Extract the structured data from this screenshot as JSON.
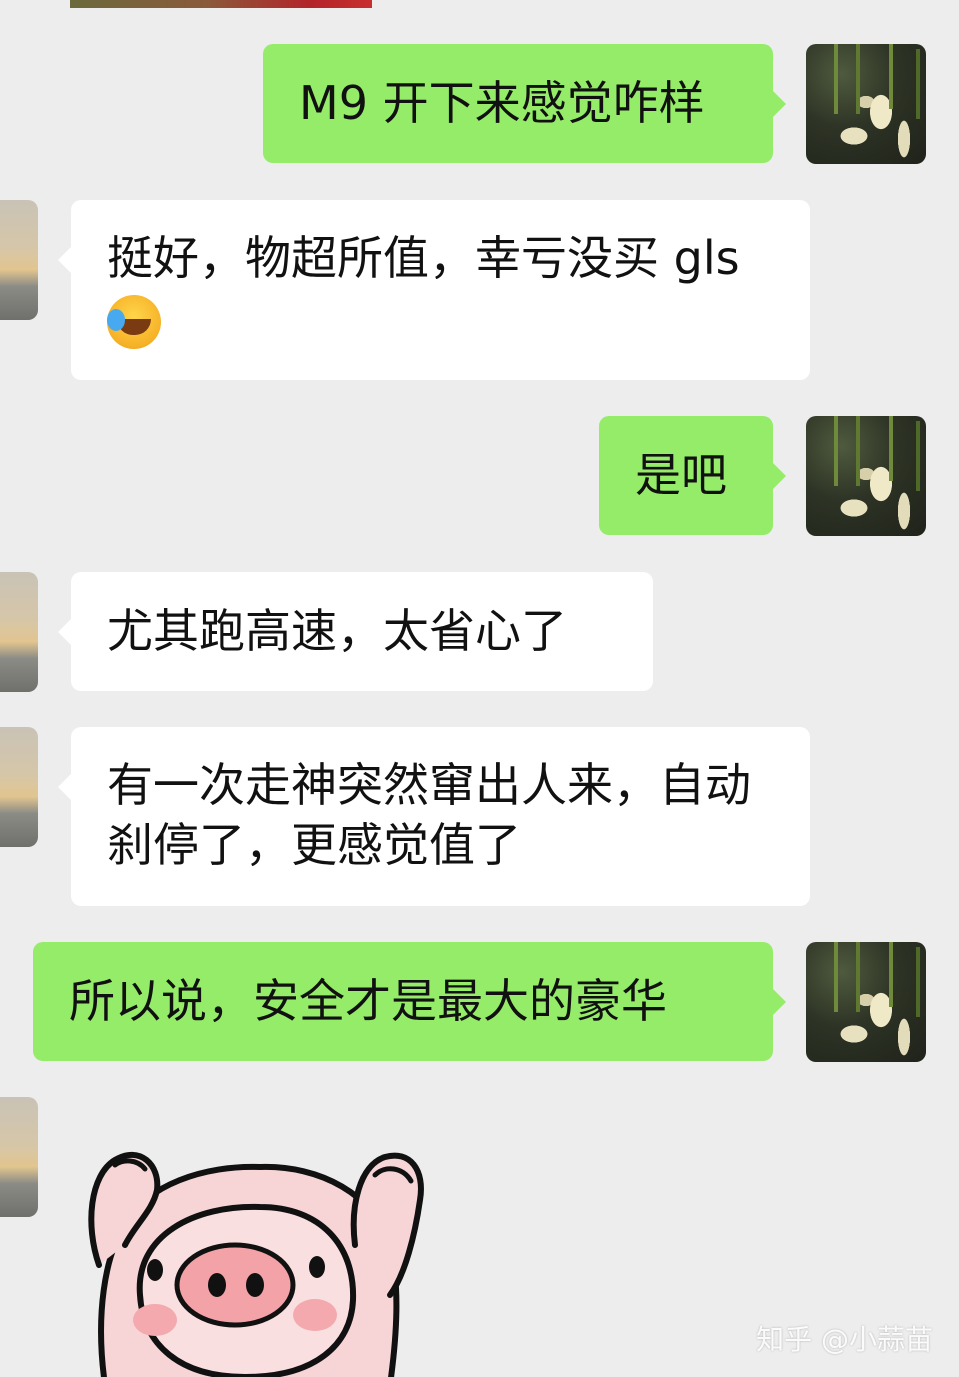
{
  "messages": [
    {
      "side": "me",
      "text": "M9 开下来感觉咋样"
    },
    {
      "side": "other",
      "text": "挺好，物超所值，幸亏没买 gls",
      "emoji": "face-with-tears-of-joy-icon"
    },
    {
      "side": "me",
      "text": "是吧"
    },
    {
      "side": "other",
      "text": "尤其跑高速，太省心了"
    },
    {
      "side": "other",
      "text": "有一次走神突然窜出人来，自动刹停了，更感觉值了"
    },
    {
      "side": "me",
      "text": "所以说，安全才是最大的豪华"
    },
    {
      "side": "other",
      "sticker": "pig-sticker-icon"
    }
  ],
  "watermark": "知乎 @小蒜苗",
  "colors": {
    "background": "#ededed",
    "my_bubble": "#95ec69",
    "their_bubble": "#ffffff"
  }
}
